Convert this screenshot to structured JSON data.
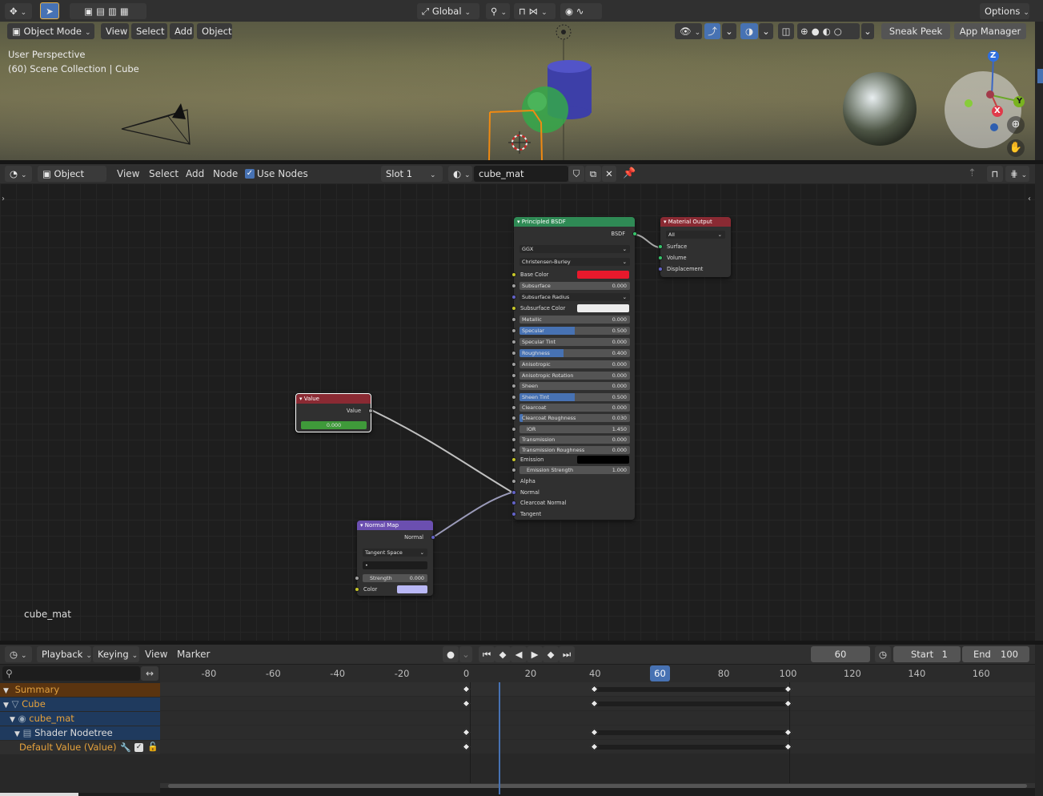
{
  "top_header": {
    "transform": "Global",
    "options": "Options"
  },
  "viewport_header": {
    "mode": "Object Mode",
    "menus": [
      "View",
      "Select",
      "Add",
      "Object"
    ],
    "sneak_peek": "Sneak Peek",
    "app_manager": "App Manager"
  },
  "viewport": {
    "perspective": "User Perspective",
    "collection": "(60) Scene Collection | Cube",
    "gizmo": {
      "z": "Z",
      "y": "Y",
      "x": "X"
    }
  },
  "node_header": {
    "type": "Object",
    "menus": [
      "View",
      "Select",
      "Add",
      "Node"
    ],
    "use_nodes": "Use Nodes",
    "slot": "Slot 1",
    "material": "cube_mat"
  },
  "nodes": {
    "principled": {
      "title": "Principled BSDF",
      "output": "BSDF",
      "distribution": "GGX",
      "subsurface_method": "Christensen-Burley",
      "base_color_label": "Base Color",
      "base_color": "#e8192c",
      "subsurface_color_label": "Subsurface Color",
      "subsurface_color": "#ececec",
      "subsurface_radius": "Subsurface Radius",
      "params": [
        {
          "label": "Subsurface",
          "value": "0.000",
          "fill": 0
        },
        {
          "label": "Metallic",
          "value": "0.000",
          "fill": 0
        },
        {
          "label": "Specular",
          "value": "0.500",
          "fill": 0.5
        },
        {
          "label": "Specular Tint",
          "value": "0.000",
          "fill": 0
        },
        {
          "label": "Roughness",
          "value": "0.400",
          "fill": 0.4
        },
        {
          "label": "Anisotropic",
          "value": "0.000",
          "fill": 0
        },
        {
          "label": "Anisotropic Rotation",
          "value": "0.000",
          "fill": 0
        },
        {
          "label": "Sheen",
          "value": "0.000",
          "fill": 0
        },
        {
          "label": "Sheen Tint",
          "value": "0.500",
          "fill": 0.5
        },
        {
          "label": "Clearcoat",
          "value": "0.000",
          "fill": 0
        },
        {
          "label": "Clearcoat Roughness",
          "value": "0.030",
          "fill": 0.03
        },
        {
          "label": "IOR",
          "value": "1.450",
          "fill": 0
        },
        {
          "label": "Transmission",
          "value": "0.000",
          "fill": 0
        },
        {
          "label": "Transmission Roughness",
          "value": "0.000",
          "fill": 0
        }
      ],
      "emission_label": "Emission",
      "emission_color": "#000000",
      "emission_strength_label": "Emission Strength",
      "emission_strength": "1.000",
      "inputs": [
        "Alpha",
        "Normal",
        "Clearcoat Normal",
        "Tangent"
      ]
    },
    "material_output": {
      "title": "Material Output",
      "target": "All",
      "inputs": [
        "Surface",
        "Volume",
        "Displacement"
      ]
    },
    "value": {
      "title": "Value",
      "output": "Value",
      "value": "0.000"
    },
    "normal_map": {
      "title": "Normal Map",
      "output": "Normal",
      "space": "Tangent Space",
      "uv": "•",
      "strength_label": "Strength",
      "strength": "0.000",
      "color_label": "Color",
      "color": "#b9b8f5"
    }
  },
  "node_editor_label": "cube_mat",
  "timeline_header": {
    "menus": [
      "Playback",
      "Keying",
      "View",
      "Marker"
    ],
    "current_frame": "60",
    "start_label": "Start",
    "start": "1",
    "end_label": "End",
    "end": "100"
  },
  "ruler": {
    "ticks": [
      "-80",
      "-60",
      "-40",
      "-20",
      "0",
      "20",
      "40",
      "60",
      "80",
      "100",
      "120",
      "140",
      "160"
    ],
    "current": "60"
  },
  "channels": [
    {
      "label": "Summary",
      "color": "#db9a3a"
    },
    {
      "label": "Cube",
      "color": "#e6a23c"
    },
    {
      "label": "cube_mat",
      "color": "#e6a23c"
    },
    {
      "label": "Shader Nodetree",
      "color": "#dcdcdc"
    },
    {
      "label": "Default Value (Value)",
      "color": "#e6a23c"
    }
  ]
}
